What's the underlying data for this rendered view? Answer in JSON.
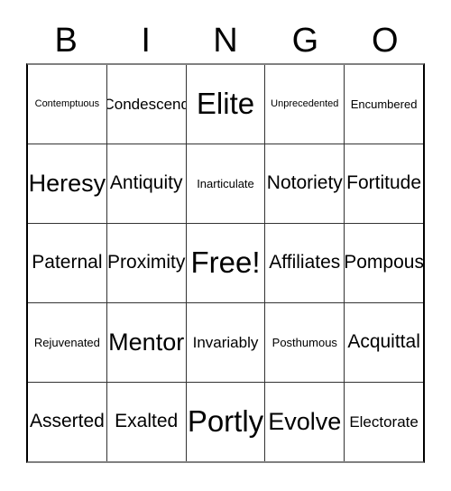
{
  "card": {
    "title": "BINGO",
    "headers": [
      "B",
      "I",
      "N",
      "G",
      "O"
    ],
    "free_space_label": "Free!",
    "colors": {
      "text": "#000000",
      "grid_line": "#333333",
      "grid_outer": "#000000",
      "background": "#ffffff"
    },
    "rows": [
      {
        "cells": [
          {
            "text": "Contemptuous",
            "size": "fs-xxs"
          },
          {
            "text": "Condescend",
            "size": "fs-sm"
          },
          {
            "text": "Elite",
            "size": "fs-xl"
          },
          {
            "text": "Unprecedented",
            "size": "fs-xxs"
          },
          {
            "text": "Encumbered",
            "size": "fs-xs"
          }
        ]
      },
      {
        "cells": [
          {
            "text": "Heresy",
            "size": "fs-lg"
          },
          {
            "text": "Antiquity",
            "size": "fs-md"
          },
          {
            "text": "Inarticulate",
            "size": "fs-xs"
          },
          {
            "text": "Notoriety",
            "size": "fs-md"
          },
          {
            "text": "Fortitude",
            "size": "fs-md"
          }
        ]
      },
      {
        "cells": [
          {
            "text": "Paternal",
            "size": "fs-md"
          },
          {
            "text": "Proximity",
            "size": "fs-md"
          },
          {
            "text": "Free!",
            "size": "fs-xl"
          },
          {
            "text": "Affiliates",
            "size": "fs-md"
          },
          {
            "text": "Pompous",
            "size": "fs-md"
          }
        ]
      },
      {
        "cells": [
          {
            "text": "Rejuvenated",
            "size": "fs-xs"
          },
          {
            "text": "Mentor",
            "size": "fs-lg"
          },
          {
            "text": "Invariably",
            "size": "fs-sm"
          },
          {
            "text": "Posthumous",
            "size": "fs-xs"
          },
          {
            "text": "Acquittal",
            "size": "fs-md"
          }
        ]
      },
      {
        "cells": [
          {
            "text": "Asserted",
            "size": "fs-md"
          },
          {
            "text": "Exalted",
            "size": "fs-md"
          },
          {
            "text": "Portly",
            "size": "fs-xl"
          },
          {
            "text": "Evolve",
            "size": "fs-lg"
          },
          {
            "text": "Electorate",
            "size": "fs-sm"
          }
        ]
      }
    ]
  }
}
